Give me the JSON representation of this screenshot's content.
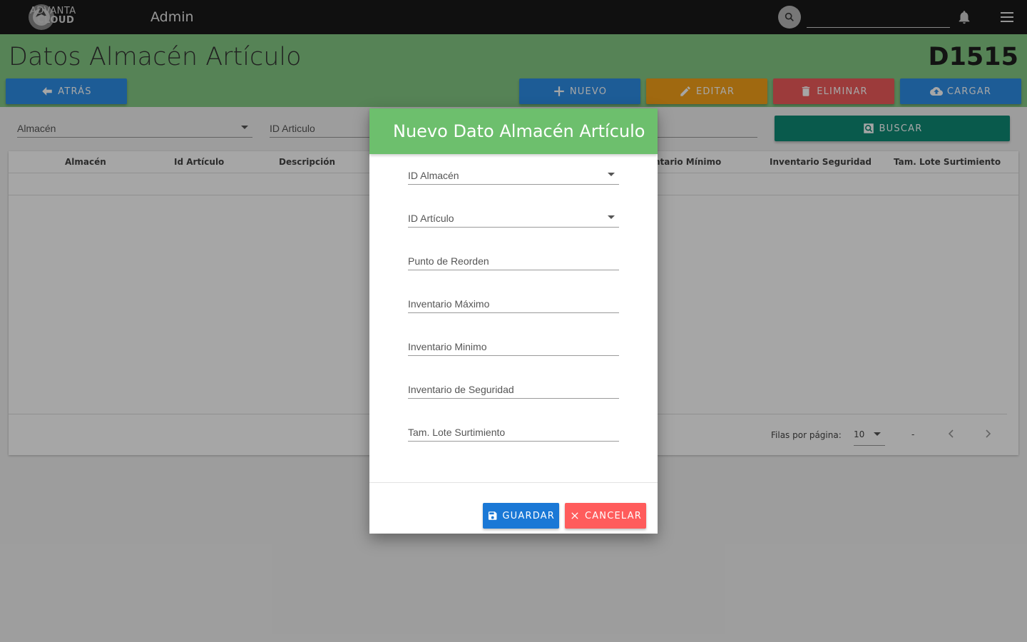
{
  "app": {
    "logo_line1": "ADVANTA",
    "logo_line2": "CLOUD",
    "section": "Admin",
    "search_value": ""
  },
  "page": {
    "title": "Datos Almacén Artículo",
    "code": "D1515"
  },
  "actions": {
    "back": "ATRÁS",
    "new": "NUEVO",
    "edit": "EDITAR",
    "delete": "ELIMINAR",
    "load": "CARGAR",
    "search": "BUSCAR"
  },
  "filters": {
    "almacen": "Almacén",
    "id_articulo": "ID Articulo",
    "third": ""
  },
  "table": {
    "columns": [
      "Almacén",
      "Id Artículo",
      "Descripción",
      "Inventario Mínimo",
      "Inventario Seguridad",
      "Tam. Lote Surtimiento"
    ],
    "rows_per_page_label": "Filas por página:",
    "rows_per_page_value": "10",
    "range_text": "-"
  },
  "modal": {
    "title": "Nuevo Dato Almacén Artículo",
    "fields": [
      "ID Almacén",
      "ID Artículo",
      "Punto de Reorden",
      "Inventario Máximo",
      "Inventario Minimo",
      "Inventario de Seguridad",
      "Tam. Lote Surtimiento"
    ],
    "save": "GUARDAR",
    "cancel": "CANCELAR"
  },
  "colors": {
    "topbar": "#1a1a1a",
    "header": "#85c985",
    "primary": "#2d8ee6",
    "warning": "#f6a21a",
    "danger": "#f05b5b",
    "search": "#0f8a75",
    "modal_header": "#6dbf6d"
  },
  "icons": {
    "search": "magnifier-icon",
    "bell": "bell-icon",
    "menu": "hamburger-icon",
    "back": "arrow-left-icon",
    "new": "plus-icon",
    "edit": "pencil-icon",
    "delete": "trash-icon",
    "load": "cloud-upload-icon",
    "save": "floppy-icon",
    "cancel": "close-icon"
  }
}
